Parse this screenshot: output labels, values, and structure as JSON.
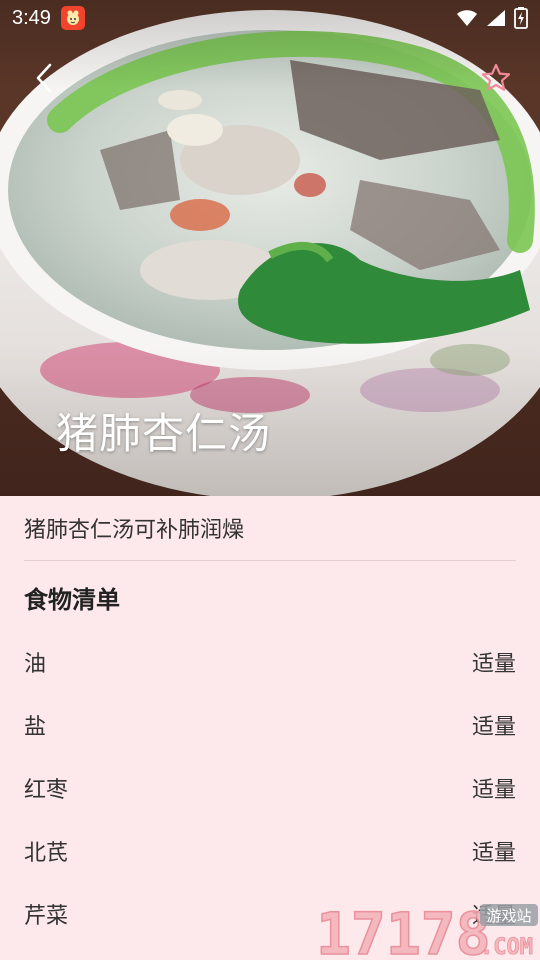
{
  "status_bar": {
    "time": "3:49",
    "app_icon": "cartoon-app-icon",
    "icons": [
      "wifi-icon",
      "signal-icon",
      "battery-icon"
    ]
  },
  "nav": {
    "back_icon": "chevron-left-icon",
    "favorite_icon": "star-outline-icon",
    "favorite_color": "#f08a98"
  },
  "recipe": {
    "title": "猪肺杏仁汤",
    "description": "猪肺杏仁汤可补肺润燥"
  },
  "ingredients_section": {
    "title": "食物清单",
    "items": [
      {
        "name": "油",
        "amount": "适量"
      },
      {
        "name": "盐",
        "amount": "适量"
      },
      {
        "name": "红枣",
        "amount": "适量"
      },
      {
        "name": "北芪",
        "amount": "适量"
      },
      {
        "name": "芹菜",
        "amount": "适量"
      }
    ]
  },
  "watermark": {
    "number": "17178",
    "domain": ".COM",
    "site": "游戏站"
  },
  "colors": {
    "background": "#fde8ec",
    "text": "#333333",
    "heading": "#222222"
  }
}
